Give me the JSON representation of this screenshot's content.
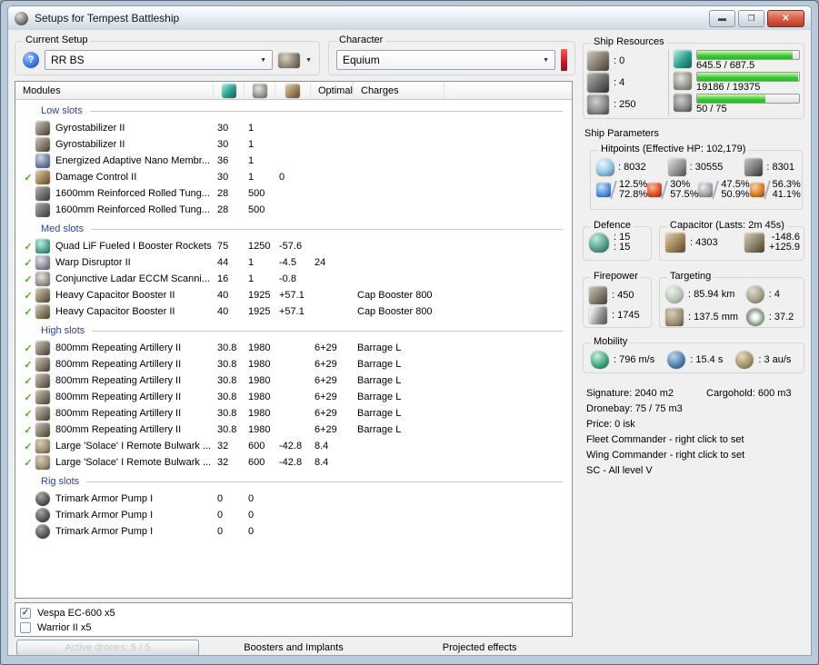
{
  "window": {
    "title": "Setups for Tempest Battleship"
  },
  "toolbar": {
    "current_setup": {
      "label": "Current Setup",
      "value": "RR BS"
    },
    "character": {
      "label": "Character",
      "value": "Equium"
    }
  },
  "modules_table": {
    "columns": {
      "modules": "Modules",
      "optimal": "Optimal",
      "charges": "Charges"
    },
    "sections": [
      {
        "title": "Low slots",
        "rows": [
          {
            "checked": false,
            "icon": "turret",
            "name": "Gyrostabilizer II",
            "cpu": "30",
            "pg": "1",
            "cap": "",
            "optimal": "",
            "charges": ""
          },
          {
            "checked": false,
            "icon": "turret",
            "name": "Gyrostabilizer II",
            "cpu": "30",
            "pg": "1",
            "cap": "",
            "optimal": "",
            "charges": ""
          },
          {
            "checked": false,
            "icon": "nano-membrane",
            "name": "Energized Adaptive Nano Membr...",
            "cpu": "36",
            "pg": "1",
            "cap": "",
            "optimal": "",
            "charges": ""
          },
          {
            "checked": true,
            "icon": "capacitor",
            "name": "Damage Control II",
            "cpu": "30",
            "pg": "1",
            "cap": "0",
            "optimal": "",
            "charges": ""
          },
          {
            "checked": false,
            "icon": "armor-plate",
            "name": "1600mm Reinforced Rolled Tung...",
            "cpu": "28",
            "pg": "500",
            "cap": "",
            "optimal": "",
            "charges": ""
          },
          {
            "checked": false,
            "icon": "armor-plate",
            "name": "1600mm Reinforced Rolled Tung...",
            "cpu": "28",
            "pg": "500",
            "cap": "",
            "optimal": "",
            "charges": ""
          }
        ]
      },
      {
        "title": "Med slots",
        "rows": [
          {
            "checked": true,
            "icon": "afterburner",
            "name": "Quad LiF Fueled I Booster Rockets",
            "cpu": "75",
            "pg": "1250",
            "cap": "-57.6",
            "optimal": "",
            "charges": ""
          },
          {
            "checked": true,
            "icon": "warp-disruptor",
            "name": "Warp Disruptor II",
            "cpu": "44",
            "pg": "1",
            "cap": "-4.5",
            "optimal": "24",
            "charges": ""
          },
          {
            "checked": true,
            "icon": "powergrid",
            "name": "Conjunctive Ladar ECCM Scanni...",
            "cpu": "16",
            "pg": "1",
            "cap": "-0.8",
            "optimal": "",
            "charges": ""
          },
          {
            "checked": true,
            "icon": "injector",
            "name": "Heavy Capacitor Booster II",
            "cpu": "40",
            "pg": "1925",
            "cap": "+57.1",
            "optimal": "",
            "charges": "Cap Booster 800"
          },
          {
            "checked": true,
            "icon": "injector",
            "name": "Heavy Capacitor Booster II",
            "cpu": "40",
            "pg": "1925",
            "cap": "+57.1",
            "optimal": "",
            "charges": "Cap Booster 800"
          }
        ]
      },
      {
        "title": "High slots",
        "rows": [
          {
            "checked": true,
            "icon": "turret",
            "name": "800mm Repeating Artillery II",
            "cpu": "30.8",
            "pg": "1980",
            "cap": "",
            "optimal": "6+29",
            "charges": "Barrage L"
          },
          {
            "checked": true,
            "icon": "turret",
            "name": "800mm Repeating Artillery II",
            "cpu": "30.8",
            "pg": "1980",
            "cap": "",
            "optimal": "6+29",
            "charges": "Barrage L"
          },
          {
            "checked": true,
            "icon": "turret",
            "name": "800mm Repeating Artillery II",
            "cpu": "30.8",
            "pg": "1980",
            "cap": "",
            "optimal": "6+29",
            "charges": "Barrage L"
          },
          {
            "checked": true,
            "icon": "turret",
            "name": "800mm Repeating Artillery II",
            "cpu": "30.8",
            "pg": "1980",
            "cap": "",
            "optimal": "6+29",
            "charges": "Barrage L"
          },
          {
            "checked": true,
            "icon": "turret",
            "name": "800mm Repeating Artillery II",
            "cpu": "30.8",
            "pg": "1980",
            "cap": "",
            "optimal": "6+29",
            "charges": "Barrage L"
          },
          {
            "checked": true,
            "icon": "turret",
            "name": "800mm Repeating Artillery II",
            "cpu": "30.8",
            "pg": "1980",
            "cap": "",
            "optimal": "6+29",
            "charges": "Barrage L"
          },
          {
            "checked": true,
            "icon": "scanres",
            "name": "Large 'Solace' I Remote Bulwark ...",
            "cpu": "32",
            "pg": "600",
            "cap": "-42.8",
            "optimal": "8.4",
            "charges": ""
          },
          {
            "checked": true,
            "icon": "scanres",
            "name": "Large 'Solace' I Remote Bulwark ...",
            "cpu": "32",
            "pg": "600",
            "cap": "-42.8",
            "optimal": "8.4",
            "charges": ""
          }
        ]
      },
      {
        "title": "Rig slots",
        "rows": [
          {
            "checked": false,
            "icon": "rig",
            "name": "Trimark Armor Pump I",
            "cpu": "0",
            "pg": "0",
            "cap": "",
            "optimal": "",
            "charges": ""
          },
          {
            "checked": false,
            "icon": "rig",
            "name": "Trimark Armor Pump I",
            "cpu": "0",
            "pg": "0",
            "cap": "",
            "optimal": "",
            "charges": ""
          },
          {
            "checked": false,
            "icon": "rig",
            "name": "Trimark Armor Pump I",
            "cpu": "0",
            "pg": "0",
            "cap": "",
            "optimal": "",
            "charges": ""
          }
        ]
      }
    ]
  },
  "drones": {
    "items": [
      {
        "checked": true,
        "name": "Vespa EC-600 x5"
      },
      {
        "checked": false,
        "name": "Warrior II x5"
      }
    ]
  },
  "bottom_bar": {
    "active_drones": "Active drones: 5 / 5",
    "boosters": "Boosters and Implants",
    "projected": "Projected effects"
  },
  "ship_resources": {
    "title": "Ship Resources",
    "slots": [
      {
        "icon": "turret",
        "value": ": 0"
      },
      {
        "icon": "launcher",
        "value": ": 4"
      },
      {
        "icon": "calibration",
        "value": ": 250"
      }
    ],
    "bars": [
      {
        "icon": "cpu",
        "label": "645.5 / 687.5",
        "current": 645.5,
        "max": 687.5
      },
      {
        "icon": "powergrid",
        "label": "19186 / 19375",
        "current": 19186,
        "max": 19375
      },
      {
        "icon": "calibration",
        "label": "50 / 75",
        "current": 50,
        "max": 75
      }
    ]
  },
  "ship_parameters": {
    "title": "Ship Parameters",
    "hitpoints": {
      "title": "Hitpoints (Effective HP: 102,179)",
      "layers": [
        {
          "icon": "shield",
          "value": ": 8032"
        },
        {
          "icon": "armor",
          "value": ": 30555"
        },
        {
          "icon": "structure",
          "value": ": 8301"
        }
      ],
      "resists": [
        {
          "icon": "em",
          "top": "12.5%",
          "bottom": "72.8%"
        },
        {
          "icon": "thermal",
          "top": "30%",
          "bottom": "57.5%"
        },
        {
          "icon": "kinetic",
          "top": "47.5%",
          "bottom": "50.9%"
        },
        {
          "icon": "explosive",
          "top": "56.3%",
          "bottom": "41.1%"
        }
      ]
    },
    "defence": {
      "title": "Defence",
      "line1": ": 15",
      "line2": ": 15"
    },
    "capacitor": {
      "title": "Capacitor (Lasts: 2m 45s)",
      "value": ": 4303",
      "out": "-148.6",
      "in": "+125.9"
    },
    "firepower": {
      "title": "Firepower",
      "volley": ": 450",
      "dps": ": 1745"
    },
    "targeting": {
      "title": "Targeting",
      "range": ": 85.94 km",
      "max_targets": ": 4",
      "scan_res": ": 137.5 mm",
      "sensor": ": 37.2"
    },
    "mobility": {
      "title": "Mobility",
      "speed": ": 796 m/s",
      "align": ": 15.4 s",
      "warp": ": 3 au/s"
    },
    "info": {
      "signature": "Signature: 2040 m2",
      "cargohold": "Cargohold: 600 m3",
      "dronebay": "Dronebay: 75 / 75 m3",
      "price": "Price: 0 isk",
      "fleet": "Fleet Commander - right click to set",
      "wing": "Wing Commander - right click to set",
      "sc": "SC - All level V"
    }
  }
}
